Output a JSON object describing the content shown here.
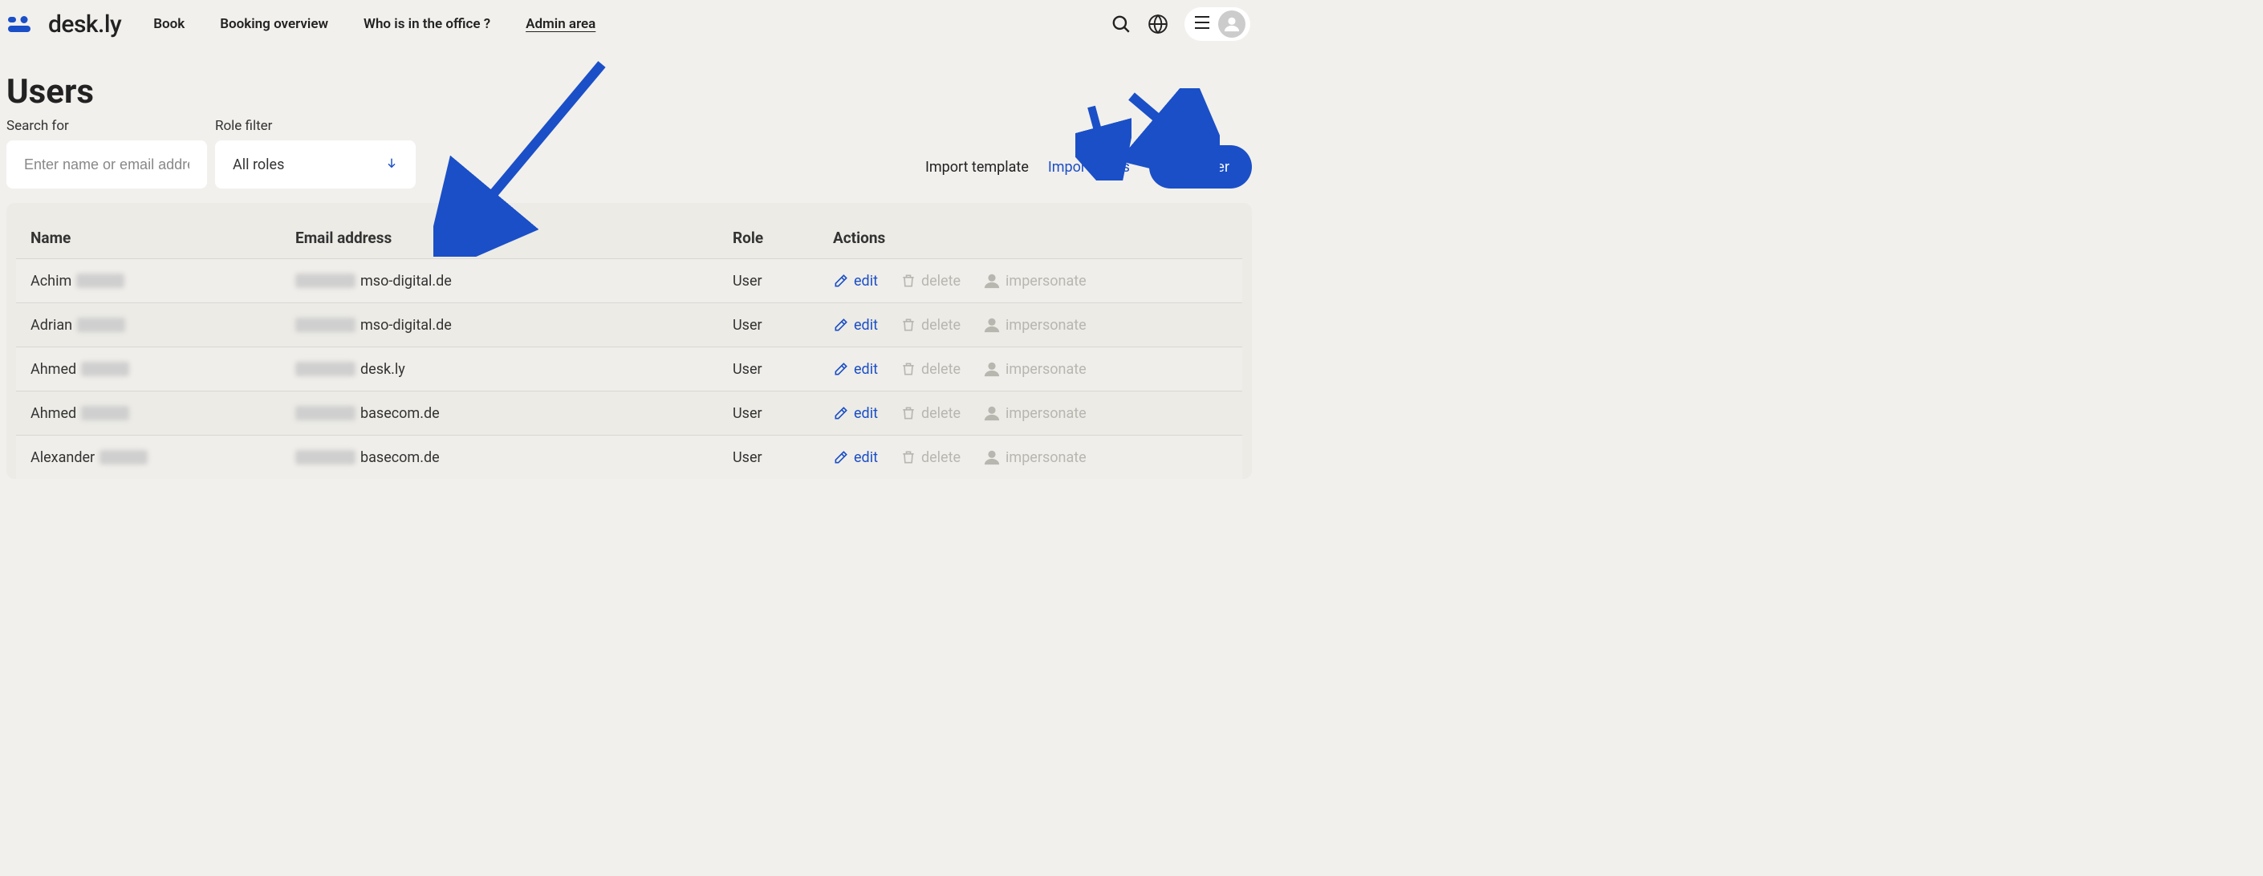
{
  "brand": {
    "name": "desk.ly"
  },
  "nav": {
    "items": [
      {
        "label": "Book"
      },
      {
        "label": "Booking overview"
      },
      {
        "label": "Who is in the office ?"
      },
      {
        "label": "Admin area"
      }
    ]
  },
  "page": {
    "title": "Users",
    "search_label": "Search for",
    "search_placeholder": "Enter name or email address",
    "role_label": "Role filter",
    "role_value": "All roles",
    "import_template": "Import template",
    "import_users": "Import users",
    "add_user": "Add user"
  },
  "table": {
    "headers": {
      "name": "Name",
      "email": "Email address",
      "role": "Role",
      "actions": "Actions"
    },
    "action_labels": {
      "edit": "edit",
      "delete": "delete",
      "impersonate": "impersonate"
    },
    "rows": [
      {
        "name_visible": "Achim",
        "email_visible": "mso-digital.de",
        "role": "User"
      },
      {
        "name_visible": "Adrian",
        "email_visible": "mso-digital.de",
        "role": "User"
      },
      {
        "name_visible": "Ahmed",
        "email_visible": "desk.ly",
        "role": "User"
      },
      {
        "name_visible": "Ahmed",
        "email_visible": "basecom.de",
        "role": "User"
      },
      {
        "name_visible": "Alexander",
        "email_visible": "basecom.de",
        "role": "User"
      }
    ]
  }
}
